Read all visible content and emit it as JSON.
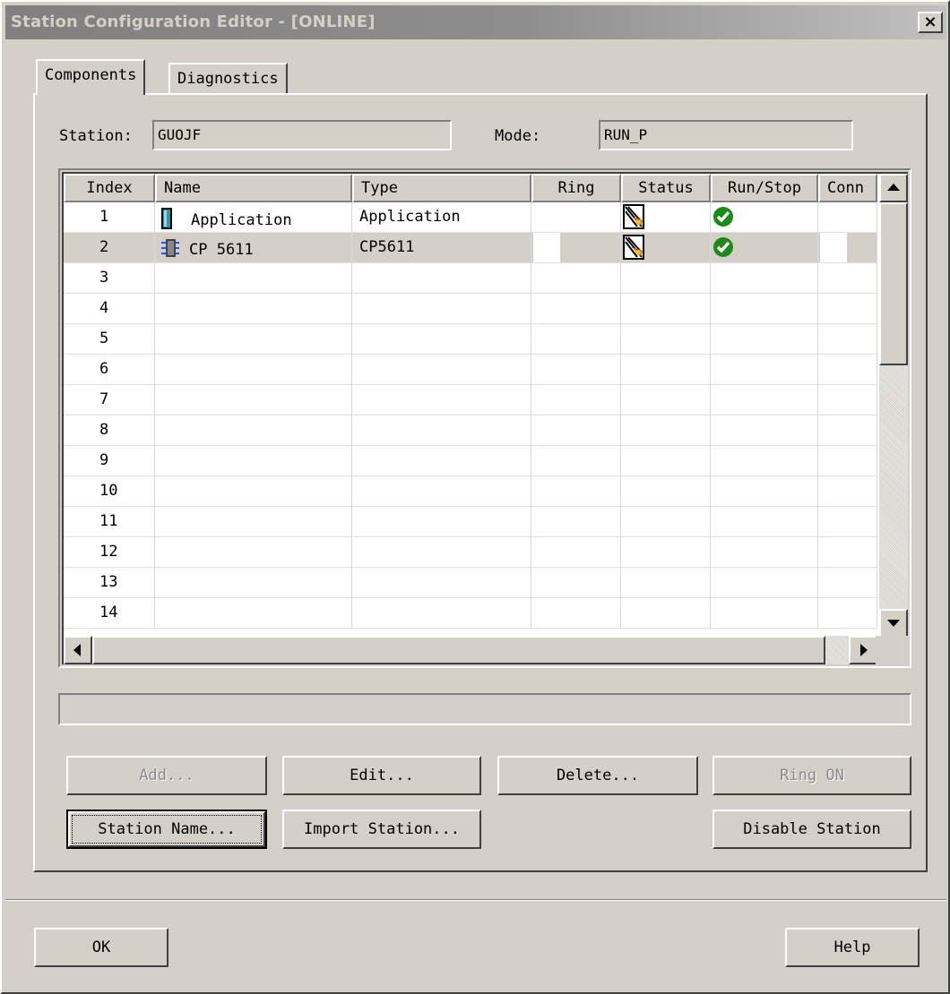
{
  "window": {
    "title": "Station Configuration Editor - [ONLINE]",
    "close": "×"
  },
  "tabs": [
    {
      "label": "Components",
      "active": true
    },
    {
      "label": "Diagnostics",
      "active": false
    }
  ],
  "station": {
    "label": "Station:",
    "value": "GUOJF"
  },
  "mode": {
    "label": "Mode:",
    "value": "RUN_P"
  },
  "table": {
    "columns": [
      "Index",
      "Name",
      "Type",
      "Ring",
      "Status",
      "Run/Stop",
      "Conn"
    ],
    "rows": [
      {
        "index": "1",
        "name": "Application",
        "type": "Application",
        "icon": "application-icon",
        "status": "status-icon",
        "runstop": "run-ok-icon"
      },
      {
        "index": "2",
        "name": "CP 5611",
        "type": "CP5611",
        "icon": "cp-card-icon",
        "status": "status-icon",
        "runstop": "run-ok-icon"
      },
      {
        "index": "3"
      },
      {
        "index": "4"
      },
      {
        "index": "5"
      },
      {
        "index": "6"
      },
      {
        "index": "7"
      },
      {
        "index": "8"
      },
      {
        "index": "9"
      },
      {
        "index": "10"
      },
      {
        "index": "11"
      },
      {
        "index": "12"
      },
      {
        "index": "13"
      },
      {
        "index": "14"
      }
    ]
  },
  "buttons": {
    "add": "Add...",
    "edit": "Edit...",
    "delete": "Delete...",
    "ring_on": "Ring ON",
    "station_name": "Station Name...",
    "import_station": "Import Station...",
    "disable_station": "Disable Station",
    "ok": "OK",
    "help": "Help"
  },
  "colors": {
    "face": "#d4d0c8",
    "title_gradient_start": "#808080",
    "ok_green": "#1a8a1a"
  }
}
